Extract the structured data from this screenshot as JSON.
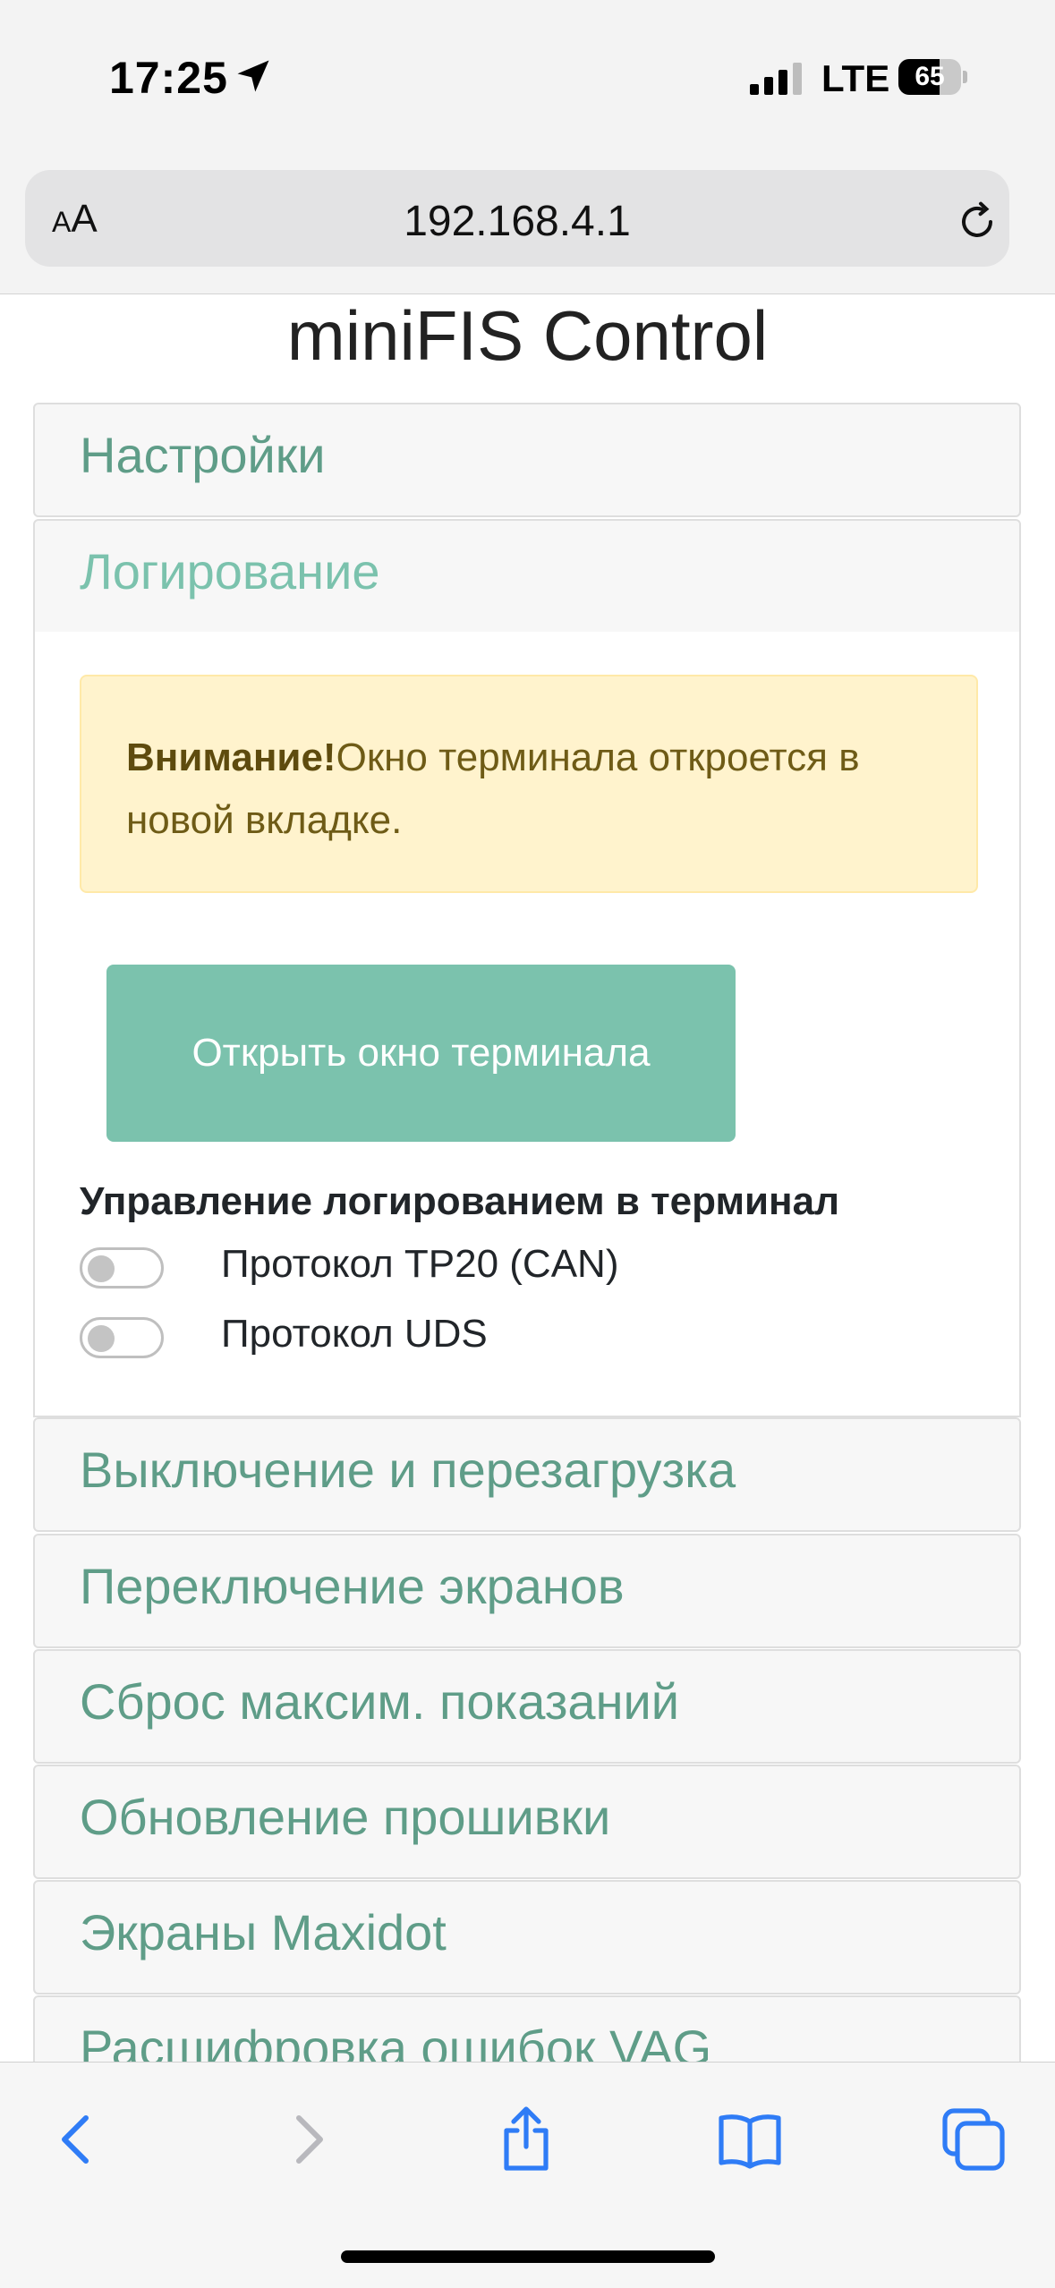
{
  "status_bar": {
    "time": "17:25",
    "network": "LTE",
    "battery": "65",
    "battery_level": 0.65
  },
  "browser": {
    "text_size_label_small": "A",
    "text_size_label_large": "A",
    "url": "192.168.4.1"
  },
  "page": {
    "title": "miniFIS Control",
    "sections": [
      {
        "title": "Настройки"
      },
      {
        "title": "Логирование"
      }
    ],
    "logging_panel": {
      "alert_bold": "Внимание!",
      "alert_text": "Окно терминала откроется в новой вкладке.",
      "open_terminal_button": "Открыть окно терминала",
      "control_heading": "Управление логированием в терминал",
      "toggles": [
        {
          "label": "Протокол TP20 (CAN)",
          "on": false
        },
        {
          "label": "Протокол UDS",
          "on": false
        }
      ]
    },
    "more_sections": [
      {
        "title": "Выключение и перезагрузка"
      },
      {
        "title": "Переключение экранов"
      },
      {
        "title": "Сброс максим. показаний"
      },
      {
        "title": "Обновление прошивки"
      },
      {
        "title": "Экраны Maxidot"
      },
      {
        "title": "Расшифровка ошибок VAG"
      }
    ]
  },
  "colors": {
    "accent": "#7bc2ad",
    "section_title": "#5f9d88",
    "alert_bg": "#fff3cd",
    "ios_blue": "#2f7cf6"
  },
  "toolbar_icons": [
    "back-icon",
    "forward-icon",
    "share-icon",
    "bookmarks-icon",
    "tabs-icon"
  ]
}
